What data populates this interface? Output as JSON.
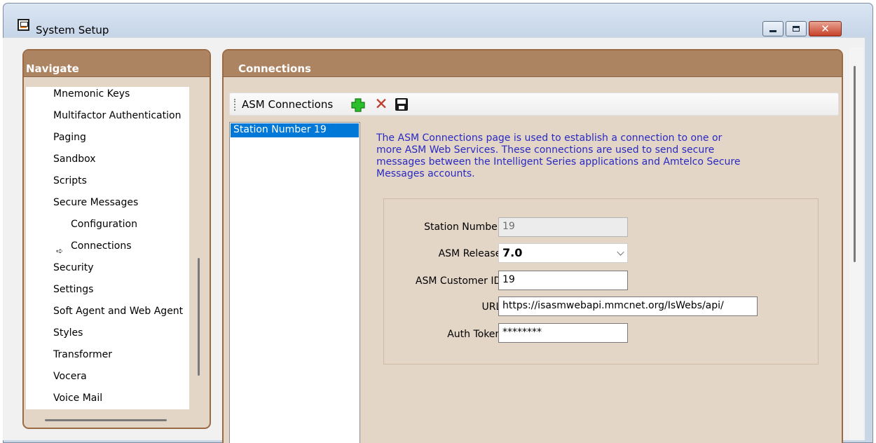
{
  "window": {
    "title": "System Setup",
    "close_glyph": "✕"
  },
  "navigate": {
    "header": "Navigate",
    "items": [
      "Mnemonic Keys",
      "Multifactor Authentication",
      "Paging",
      "Sandbox",
      "Scripts",
      "Secure Messages",
      "Configuration",
      "Connections",
      "Security",
      "Settings",
      "Soft Agent and Web Agent",
      "Styles",
      "Transformer",
      "Vocera",
      "Voice Mail"
    ],
    "selected_item": "Connections",
    "selected_arrow": "➪"
  },
  "connections": {
    "header": "Connections",
    "toolbar_label": "ASM Connections",
    "delete_glyph": "✕",
    "stations": [
      "Station Number 19"
    ],
    "description": "The ASM Connections page is used to establish a connection to one or more ASM Web Services. These connections are used to send secure messages between the Intelligent Series applications and Amtelco Secure Messages accounts.",
    "form": {
      "station_number_label": "Station Number:",
      "station_number": "19",
      "asm_release_label": "ASM Release:",
      "asm_release": "7.0",
      "customer_id_label": "ASM Customer ID:",
      "customer_id": "19",
      "url_label": "URL:",
      "url": "https://isasmwebapi.mmcnet.org/IsWebs/api/",
      "auth_token_label": "Auth Token:",
      "auth_token": "********"
    }
  },
  "colors": {
    "panel_header": "#ad8462",
    "panel_border": "#9b6a43",
    "panel_bg": "#e4d6c7",
    "selection": "#0078d7",
    "description_text": "#2929c4",
    "add_icon": "#27b327",
    "delete_icon": "#c0392b"
  },
  "icons": {
    "app": "setup-window-icon",
    "add": "plus-icon",
    "delete": "x-icon",
    "save": "floppy-disk-icon",
    "current": "arrow-right-icon",
    "dropdown": "chevron-down-icon"
  }
}
